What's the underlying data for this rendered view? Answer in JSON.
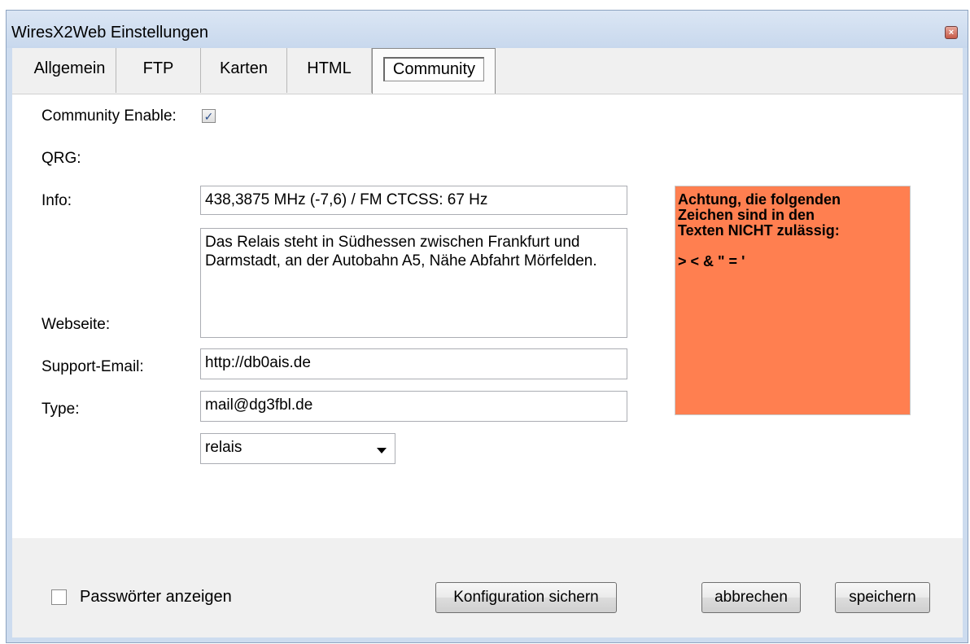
{
  "window": {
    "title": "WiresX2Web Einstellungen",
    "close_label": "×"
  },
  "tabs": [
    {
      "label": "Allgemein"
    },
    {
      "label": "FTP"
    },
    {
      "label": "Karten"
    },
    {
      "label": "HTML"
    },
    {
      "label": "Community",
      "active": true
    }
  ],
  "community": {
    "enable_label": "Community Enable:",
    "enable_checked": true,
    "enable_mark": "✓",
    "qrg_label": "QRG:",
    "qrg_value": "438,3875 MHz (-7,6) / FM CTCSS: 67 Hz",
    "info_label": "Info:",
    "info_value": "Das Relais steht in Südhessen zwischen Frankfurt und Darmstadt, an der Autobahn A5, Nähe Abfahrt Mörfelden.",
    "website_label": "Webseite:",
    "website_value": "http://db0ais.de",
    "email_label": "Support-Email:",
    "email_value": "mail@dg3fbl.de",
    "type_label": "Type:",
    "type_value": "relais",
    "warning_text": "Achtung, die folgenden\nZeichen sind in den\nTexten NICHT zulässig:\n\n> < & \" = '",
    "warning_color": "#ff7f50"
  },
  "footer": {
    "show_passwords_label": "Passwörter anzeigen",
    "show_passwords_checked": false,
    "save_config_label": "Konfiguration sichern",
    "cancel_label": "abbrechen",
    "save_label": "speichern"
  }
}
